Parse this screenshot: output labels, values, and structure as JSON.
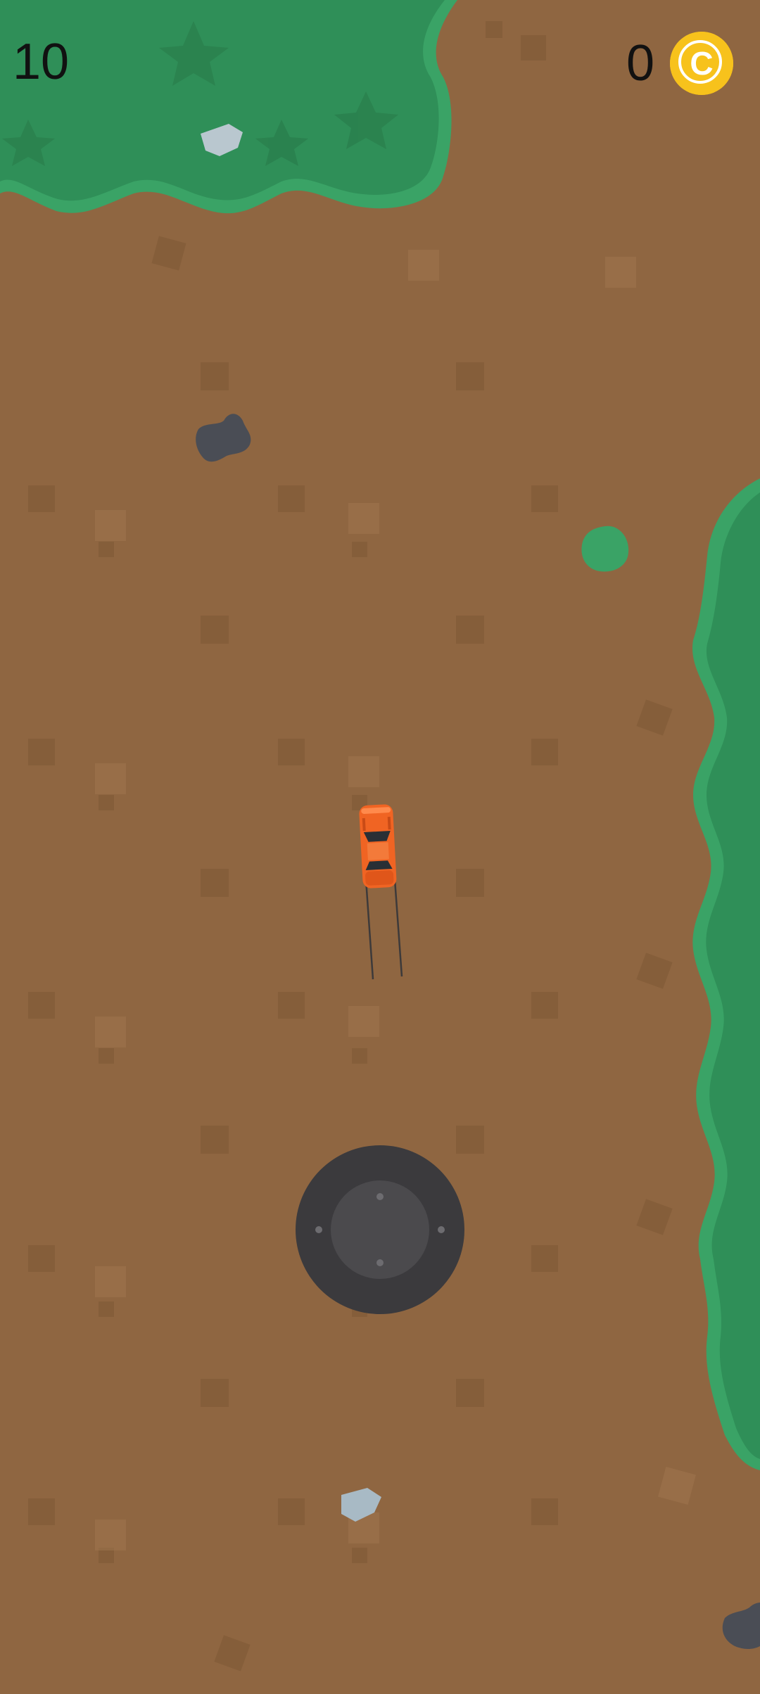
{
  "hud": {
    "score": "10",
    "coin_count": "0",
    "coin_icon": "coin-icon",
    "coin_glyph": "C"
  },
  "colors": {
    "ground": "#8f6641",
    "grass": "#2f8f58",
    "grass_edge": "#3aa366",
    "car": "#f06423",
    "joystick": "#3b3a3d",
    "coin": "#f7c21c"
  },
  "controls": {
    "joystick": "joystick-control"
  }
}
